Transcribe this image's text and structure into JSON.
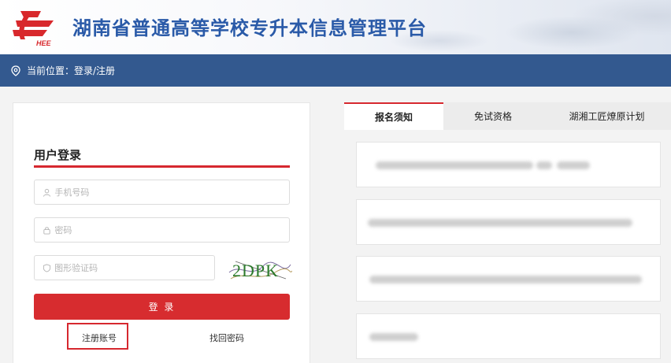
{
  "header": {
    "logo_text": "HEE",
    "site_title": "湖南省普通高等学校专升本信息管理平台"
  },
  "breadcrumb": {
    "label": "当前位置：登录/注册"
  },
  "login": {
    "title": "用户登录",
    "phone_placeholder": "手机号码",
    "password_placeholder": "密码",
    "captcha_placeholder": "图形验证码",
    "captcha_text": "2DPK",
    "login_button": "登 录",
    "register_link": "注册账号",
    "forgot_link": "找回密码"
  },
  "tabs": [
    {
      "label": "报名须知",
      "active": true
    },
    {
      "label": "免试资格",
      "active": false
    },
    {
      "label": "湖湘工匠燎原计划",
      "active": false
    }
  ],
  "colors": {
    "brand_red": "#d6282f",
    "nav_blue": "#33598f",
    "title_blue": "#2a5aa8"
  }
}
